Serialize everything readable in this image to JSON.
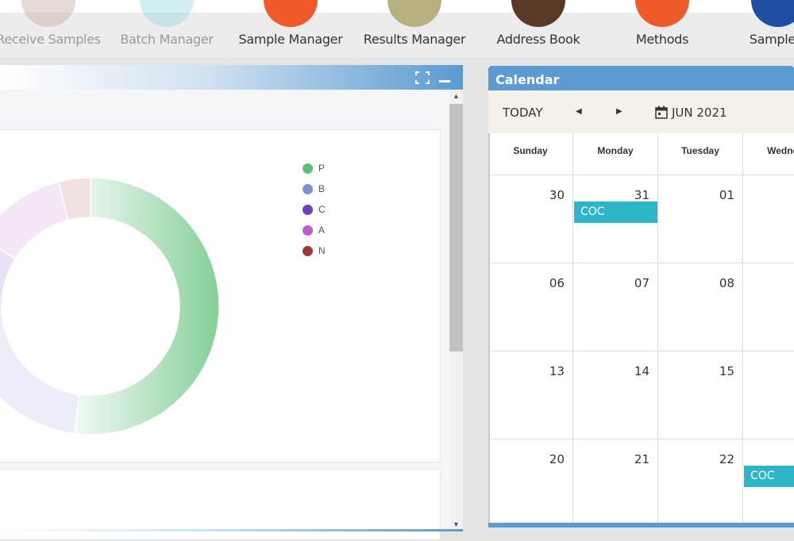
{
  "launchers": [
    {
      "label": "Receive Samples",
      "color": "#c9aaa0",
      "faded": true
    },
    {
      "label": "Batch Manager",
      "color": "#9ad9e0",
      "faded": true
    },
    {
      "label": "Sample Manager",
      "color": "#f05a28",
      "faded": false
    },
    {
      "label": "Results Manager",
      "color": "#b9b07f",
      "faded": false
    },
    {
      "label": "Address Book",
      "color": "#5a3a26",
      "faded": false
    },
    {
      "label": "Methods",
      "color": "#f05a28",
      "faded": false
    },
    {
      "label": "Sample T",
      "color": "#1f4ea3",
      "faded": false
    }
  ],
  "chart_panel": {
    "header_title": "",
    "expand_icon": "fullscreen-icon",
    "minimize_icon": "minimize-icon"
  },
  "chart_data": {
    "type": "pie",
    "donut": true,
    "legend_position": "top-right",
    "legend": [
      {
        "name": "P",
        "color": "#5cbf75"
      },
      {
        "name": "B",
        "color": "#7b8fd6"
      },
      {
        "name": "C",
        "color": "#6a3fc0"
      },
      {
        "name": "A",
        "color": "#c25ccc"
      },
      {
        "name": "N",
        "color": "#a03a36"
      }
    ],
    "values": [
      52,
      22,
      10,
      12,
      4
    ]
  },
  "calendar": {
    "title": "Calendar",
    "today_label": "TODAY",
    "prev_icon": "prev-arrow-icon",
    "next_icon": "next-arrow-icon",
    "month_label": "JUN 2021",
    "day_headers": [
      "Sunday",
      "Monday",
      "Tuesday",
      "Wednes"
    ],
    "weeks": [
      [
        "30",
        "31",
        "01",
        ""
      ],
      [
        "06",
        "07",
        "08",
        ""
      ],
      [
        "13",
        "14",
        "15",
        ""
      ],
      [
        "20",
        "21",
        "22",
        ""
      ]
    ],
    "events": [
      {
        "label": "COC",
        "week": 0,
        "day": 1
      },
      {
        "label": "COC",
        "week": 3,
        "day": 3
      }
    ]
  }
}
